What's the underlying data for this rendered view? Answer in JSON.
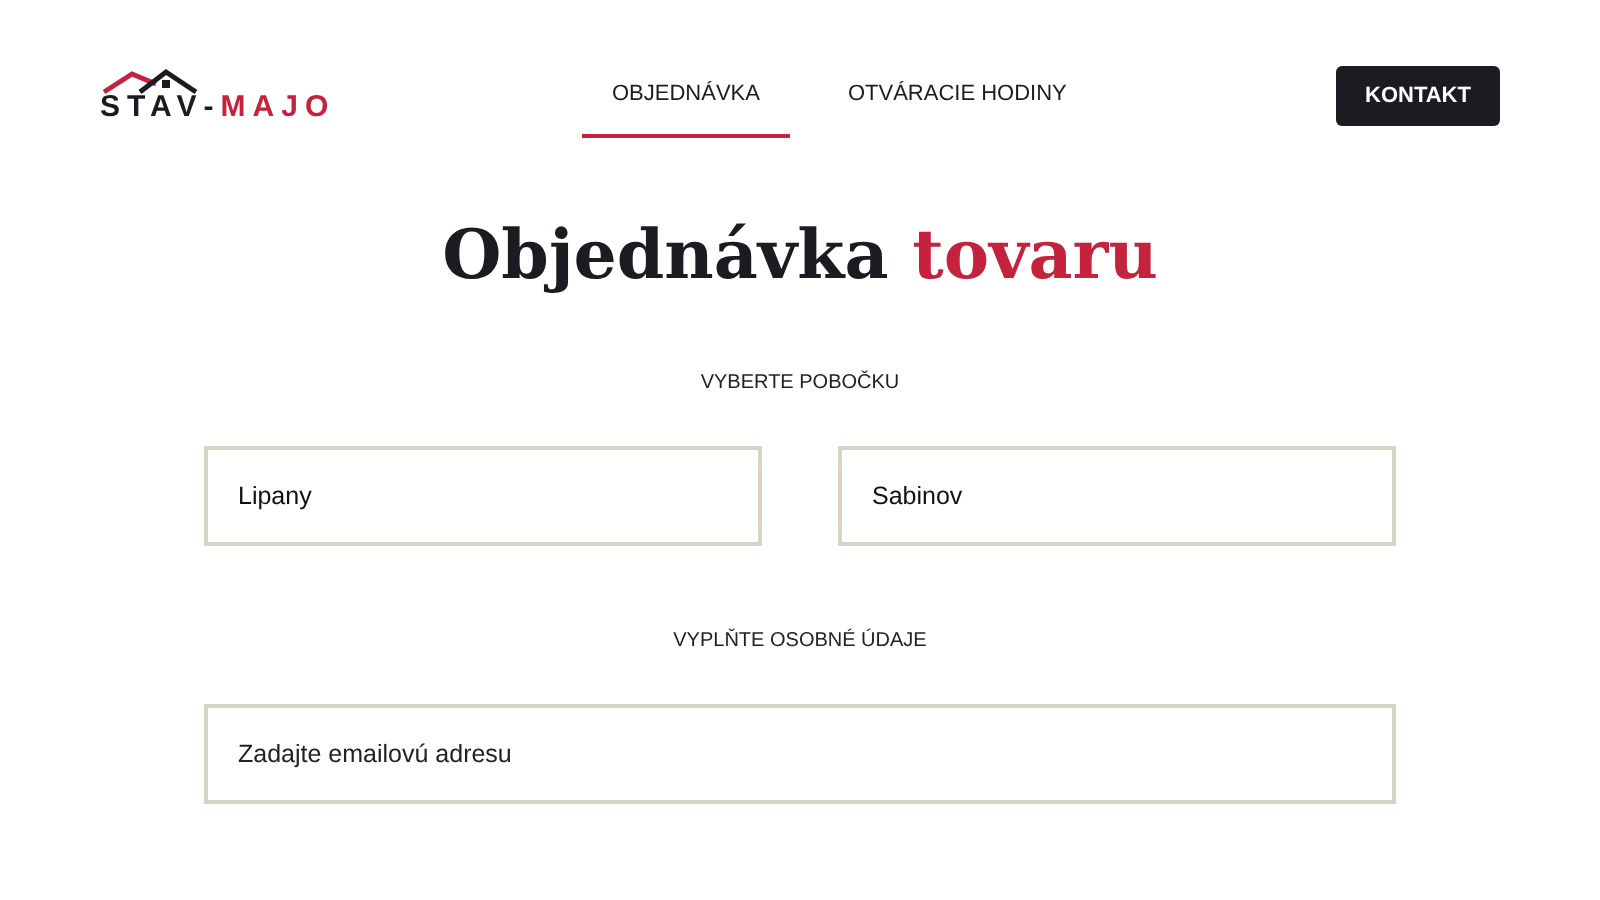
{
  "logo": {
    "first": "STAV",
    "separator": "-",
    "second": "MAJO"
  },
  "nav": [
    {
      "label": "OBJEDNÁVKA",
      "selected": true
    },
    {
      "label": "OTVÁRACIE HODINY",
      "selected": false
    }
  ],
  "contact_button": "KONTAKT",
  "title": {
    "text": "Objednávka",
    "accent": "tovaru"
  },
  "branch_section": {
    "label": "VYBERTE POBOČKU",
    "options": [
      "Lipany",
      "Sabinov"
    ]
  },
  "personal_section": {
    "label": "VYPLŇTE OSOBNÉ ÚDAJE",
    "email": {
      "placeholder": "Zadajte emailovú adresu"
    }
  }
}
